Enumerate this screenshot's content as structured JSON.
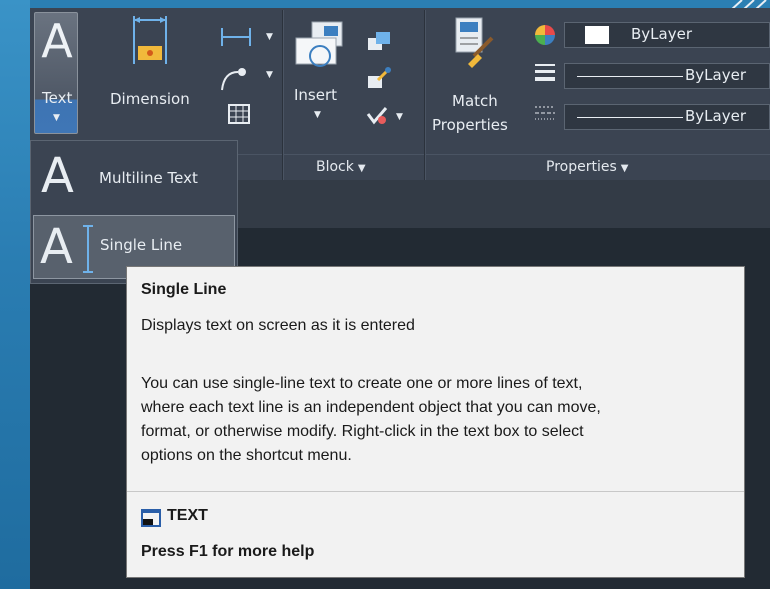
{
  "ribbon": {
    "annotation": {
      "text_label": "Text",
      "dimension_label": "Dimension"
    },
    "block": {
      "insert_label": "Insert",
      "panel_title": "Block"
    },
    "properties": {
      "match_label_1": "Match",
      "match_label_2": "Properties",
      "panel_title": "Properties",
      "color_value": "ByLayer",
      "linetype_value": "ByLayer",
      "lineweight_value": "ByLayer"
    }
  },
  "text_dropdown": {
    "items": [
      {
        "label": "Multiline Text",
        "icon": "multiline-text-icon"
      },
      {
        "label": "Single Line",
        "icon": "single-line-text-icon"
      }
    ]
  },
  "tooltip": {
    "title": "Single Line",
    "summary": "Displays text on screen as it is entered",
    "body_lines": [
      "You can use single-line text to create one or more lines of text,",
      "where each text line is an independent object that you can move,",
      "format, or otherwise modify. Right-click in the text box to select",
      "options on the shortcut menu."
    ],
    "command": "TEXT",
    "help": "Press F1 for more help"
  },
  "colors": {
    "ribbon_bg": "#3b4452",
    "accent_blue": "#3f76b6",
    "tooltip_bg": "#f2f2f2",
    "outer_bg": "#2b7fb3"
  }
}
